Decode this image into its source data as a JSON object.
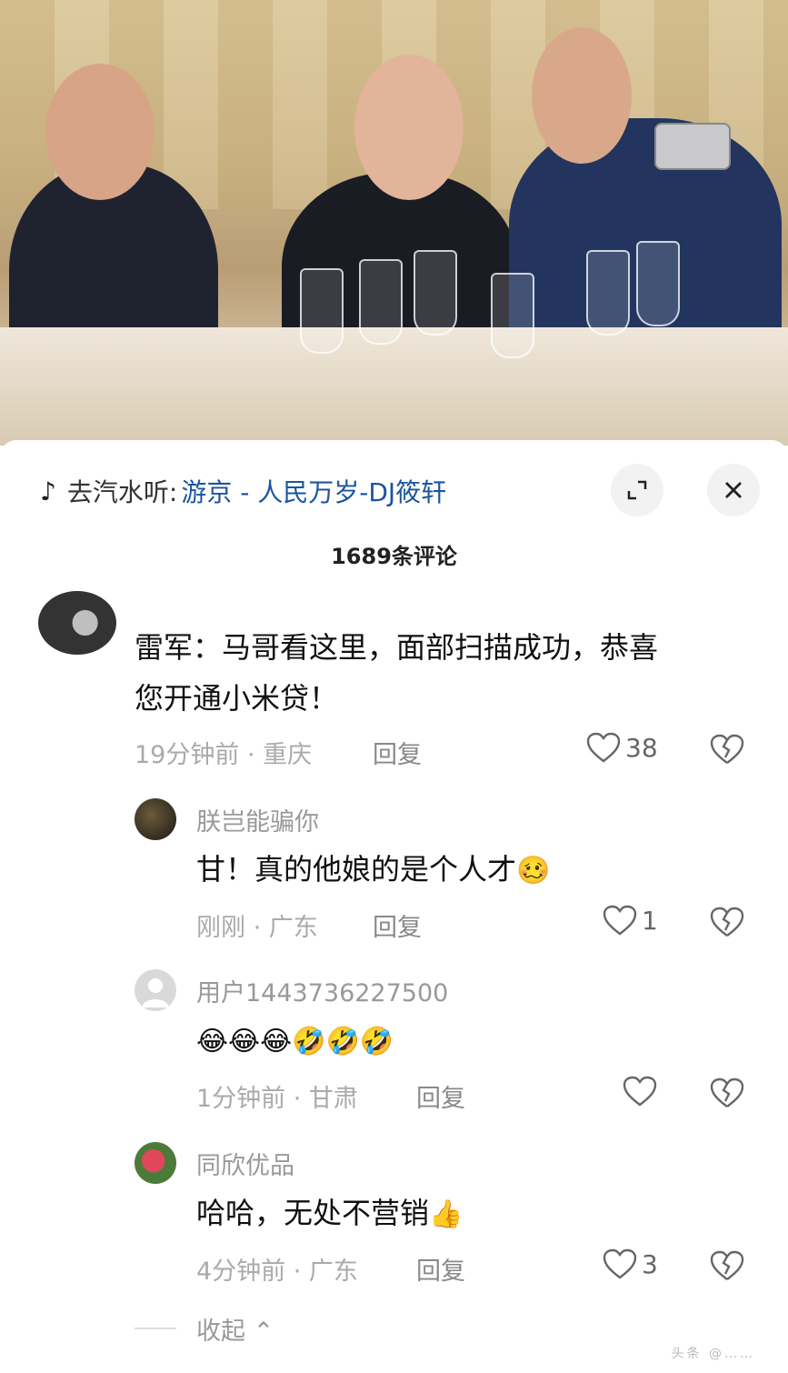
{
  "music_bar": {
    "prefix": "去汽水听:",
    "song": "游京 - 人民万岁-DJ筱轩",
    "note_icon": "music-note-icon",
    "expand_icon": "expand-icon",
    "close_icon": "close-icon"
  },
  "comment_count": "1689条评论",
  "comments": [
    {
      "text_line1": "雷军：马哥看这里，面部扫描成功，恭喜",
      "text_line2": "您开通小米贷！",
      "time": "19分钟前 · 重庆",
      "reply_label": "回复",
      "likes": "38"
    },
    {
      "user": "朕岂能骗你",
      "text": "甘！真的他娘的是个人才",
      "emoji": "🥴",
      "time": "刚刚 · 广东",
      "reply_label": "回复",
      "likes": "1"
    },
    {
      "user": "用户1443736227500",
      "emoji": "😂😂😂🤣🤣🤣",
      "time": "1分钟前 · 甘肃",
      "reply_label": "回复",
      "likes": ""
    },
    {
      "user": "同欣优品",
      "text": "哈哈，无处不营销",
      "emoji": "👍",
      "time": "4分钟前 · 广东",
      "reply_label": "回复",
      "likes": "3"
    }
  ],
  "collapse_label": "收起",
  "watermark": "头条 @……"
}
